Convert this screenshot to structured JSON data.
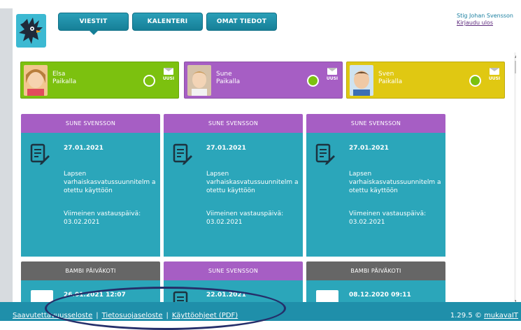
{
  "nav": {
    "tabs": [
      {
        "label": "VIESTIT",
        "active": true
      },
      {
        "label": "KALENTERI",
        "active": false
      },
      {
        "label": "OMAT TIEDOT",
        "active": false
      }
    ]
  },
  "user": {
    "name": "Stig Johan Svensson",
    "logout": "Kirjaudu ulos"
  },
  "children": [
    {
      "first": "Elsa",
      "status": "Paikalla",
      "color": "#7cc10f",
      "new_label": "UUSI"
    },
    {
      "first": "Sune",
      "status": "Paikalla",
      "color": "#a65ec4",
      "new_label": "UUSI"
    },
    {
      "first": "Sven",
      "status": "Paikalla",
      "color": "#e0c812",
      "new_label": "UUSI"
    }
  ],
  "cards": [
    {
      "header": "SUNE SVENSSON",
      "header_color": "#a65ec4",
      "date": "27.01.2021",
      "message": "Lapsen varhaiskasvatussuunnitelm a otettu käyttöön",
      "deadline_label": "Viimeinen vastauspäivä:",
      "deadline": "03.02.2021"
    },
    {
      "header": "SUNE SVENSSON",
      "header_color": "#a65ec4",
      "date": "27.01.2021",
      "message": "Lapsen varhaiskasvatussuunnitelm a otettu käyttöön",
      "deadline_label": "Viimeinen vastauspäivä:",
      "deadline": "03.02.2021"
    },
    {
      "header": "SUNE SVENSSON",
      "header_color": "#a65ec4",
      "date": "27.01.2021",
      "message": "Lapsen varhaiskasvatussuunnitelm a otettu käyttöön",
      "deadline_label": "Viimeinen vastauspäivä:",
      "deadline": "03.02.2021"
    },
    {
      "header": "BAMBI PÄIVÄKOTI",
      "header_color": "#666666",
      "date": "26.01.2021 12:07"
    },
    {
      "header": "SUNE SVENSSON",
      "header_color": "#a65ec4",
      "date": "22.01.2021"
    },
    {
      "header": "BAMBI PÄIVÄKOTI",
      "header_color": "#666666",
      "date": "08.12.2020 09:11"
    }
  ],
  "footer": {
    "links": [
      "Saavutettavuusseloste",
      "Tietosuojaseloste",
      "Käyttöohjeet (PDF)"
    ],
    "separator": "|",
    "version": "1.29.5 ©",
    "brand": "mukavaIT"
  },
  "colors": {
    "teal": "#2ba6ba",
    "footer": "#1f8faa",
    "annotation": "#252f6a"
  }
}
